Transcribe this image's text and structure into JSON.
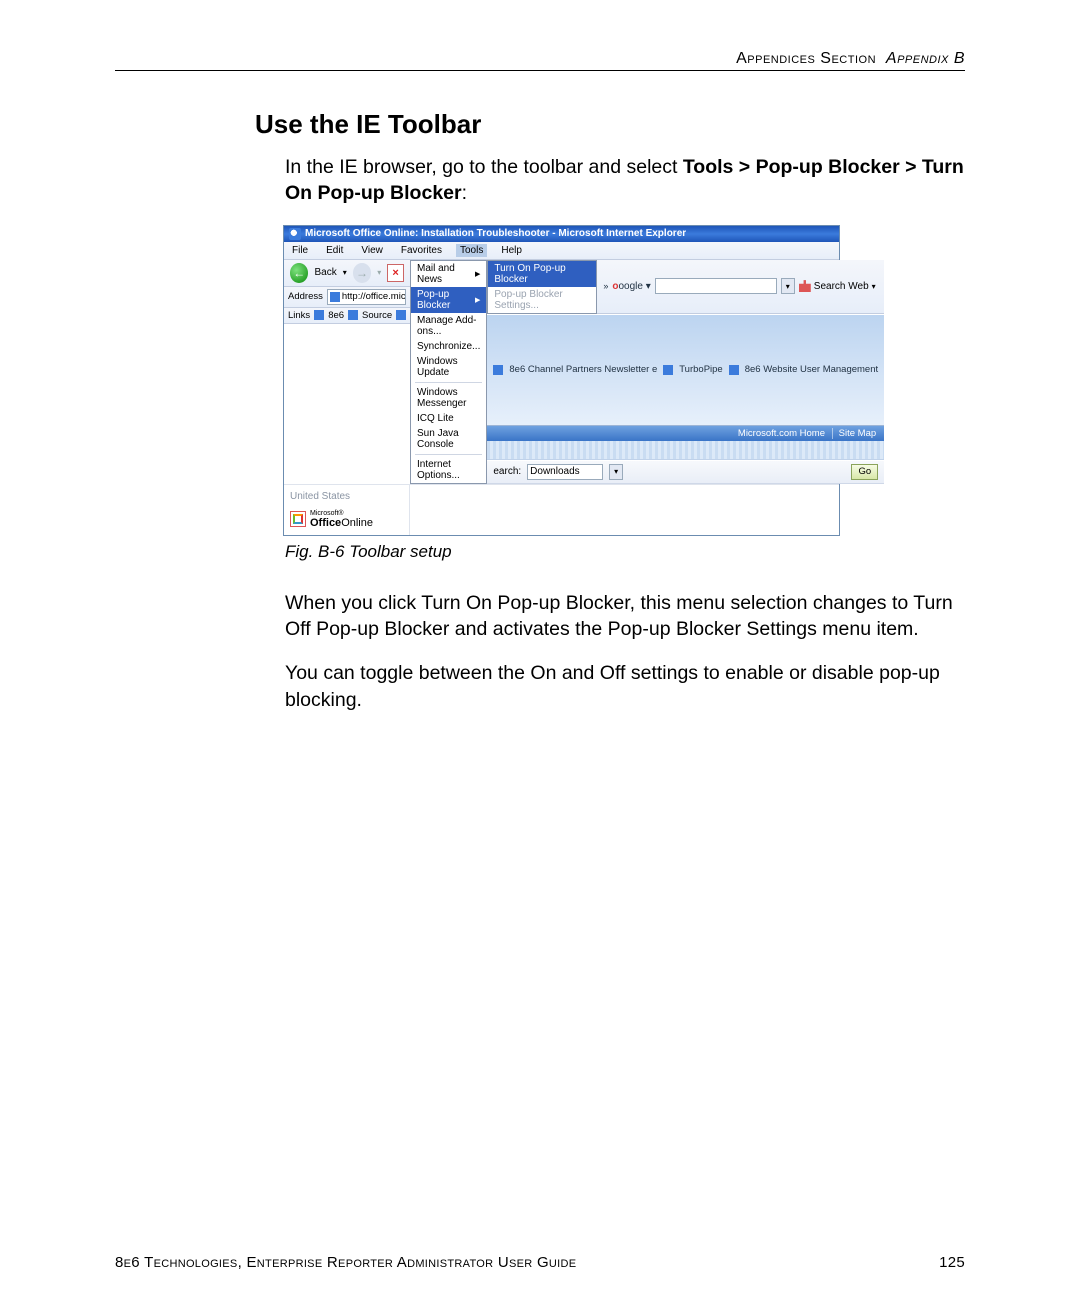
{
  "header": {
    "left": "Appendices Section",
    "right_italic": "Appendix B"
  },
  "section_title": "Use the IE Toolbar",
  "intro": {
    "pre": "In the IE browser, go to the toolbar and select ",
    "bold": "Tools > Pop-up Blocker > Turn On Pop-up Blocker",
    "post": ":"
  },
  "caption": "Fig. B-6  Toolbar setup",
  "para2": "When you click Turn On Pop-up Blocker, this menu selection changes to Turn Off Pop-up Blocker and activates the Pop-up Blocker Settings menu item.",
  "para3": "You can toggle between the On and Off settings to enable or disable pop-up blocking.",
  "footer": {
    "text": "8e6 Technologies, Enterprise Reporter Administrator User Guide",
    "page": "125"
  },
  "ie": {
    "title": "Microsoft Office Online: Installation Troubleshooter - Microsoft Internet Explorer",
    "menus": [
      "File",
      "Edit",
      "View",
      "Favorites",
      "Tools",
      "Help"
    ],
    "back": "Back",
    "address_label": "Address",
    "address_value": "http://office.microso",
    "links_label": "Links",
    "links": [
      "8e6",
      "Source"
    ],
    "tools_menu": {
      "items_top": [
        "Mail and News"
      ],
      "popup": "Pop-up Blocker",
      "addons": "Manage Add-ons...",
      "sync": "Synchronize...",
      "update": "Windows Update",
      "messenger": "Windows Messenger",
      "icq": "ICQ Lite",
      "java": "Sun Java Console",
      "opts": "Internet Options..."
    },
    "popup_submenu": {
      "turn_on": "Turn On Pop-up Blocker",
      "settings": "Pop-up Blocker Settings..."
    },
    "google_label": "oogle",
    "search_web": "Search Web",
    "bluebar": {
      "a": "8e6 Channel Partners Newsletter  e",
      "b": "TurboPipe",
      "c": "8e6 Website User Management"
    },
    "left_content": {
      "us": "United States",
      "ms": "Microsoft®",
      "office": "Office",
      "online": "Online"
    },
    "mshome": {
      "home": "Microsoft.com Home",
      "map": "Site Map"
    },
    "search_label": "earch:",
    "downloads": "Downloads",
    "go": "Go"
  }
}
